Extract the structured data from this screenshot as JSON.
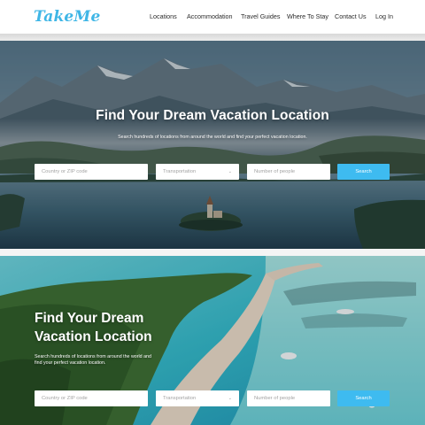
{
  "brand": {
    "logo_text": "TakeMe",
    "accent_color": "#3ebbf0"
  },
  "nav": {
    "items": [
      {
        "label": "Locations"
      },
      {
        "label": "Accommodation"
      },
      {
        "label": "Travel Guides"
      },
      {
        "label": "Where To Stay"
      },
      {
        "label": "Contact Us"
      },
      {
        "label": "Log In"
      }
    ]
  },
  "hero_top": {
    "title": "Find Your Dream Vacation Location",
    "subtitle": "Search hundreds of locations from around the world and find your perfect vacation location.",
    "search": {
      "location_placeholder": "Country or ZIP code",
      "transport_value": "Transportation",
      "people_placeholder": "Number of people",
      "button_label": "Search"
    }
  },
  "hero_bottom": {
    "title": "Find Your Dream Vacation Location",
    "subtitle": "Search hundreds of locations from around the world and find your perfect vacation location.",
    "search": {
      "location_placeholder": "Country or ZIP code",
      "transport_value": "Transportation",
      "people_placeholder": "Number of people",
      "button_label": "Search"
    }
  }
}
